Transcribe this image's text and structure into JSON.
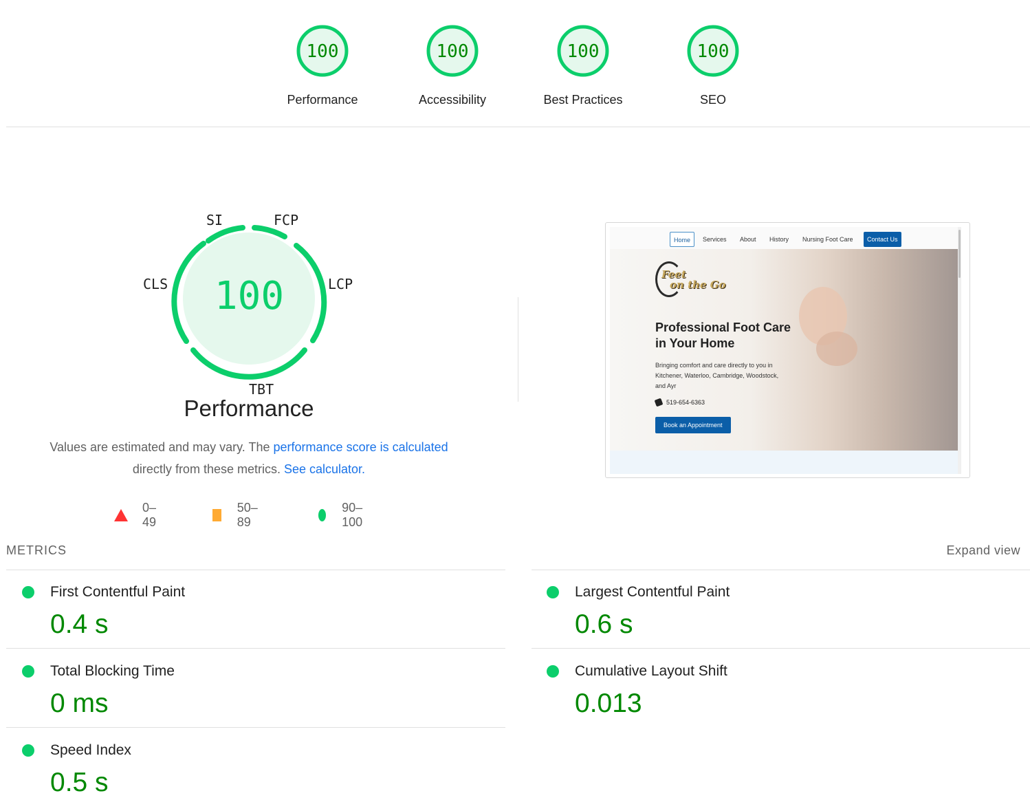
{
  "top_scores": [
    {
      "label": "Performance",
      "score": "100"
    },
    {
      "label": "Accessibility",
      "score": "100"
    },
    {
      "label": "Best Practices",
      "score": "100"
    },
    {
      "label": "SEO",
      "score": "100"
    }
  ],
  "performance_gauge": {
    "score": "100",
    "title": "Performance",
    "segments": [
      "SI",
      "FCP",
      "LCP",
      "TBT",
      "CLS"
    ]
  },
  "description": {
    "part1": "Values are estimated and may vary. The ",
    "link1": "performance score is calculated",
    "part2": "directly from these metrics. ",
    "link2": "See calculator."
  },
  "legend": [
    {
      "shape": "triangle",
      "range": "0–49",
      "color": "#ff3333"
    },
    {
      "shape": "square",
      "range": "50–89",
      "color": "#ffaa33"
    },
    {
      "shape": "circle",
      "range": "90–100",
      "color": "#0cce6b"
    }
  ],
  "screenshot": {
    "nav": [
      "Home",
      "Services",
      "About",
      "History",
      "Nursing Foot Care",
      "Contact Us"
    ],
    "logo_line1": "Feet",
    "logo_line2": "on the Go",
    "hero_title": "Professional Foot Care in Your Home",
    "hero_subtitle": "Bringing comfort and care directly to you in Kitchener, Waterloo, Cambridge, Woodstock, and Ayr",
    "phone": "519-654-6363",
    "cta": "Book an Appointment"
  },
  "metrics": {
    "header": "METRICS",
    "expand_label": "Expand view",
    "items": [
      {
        "name": "First Contentful Paint",
        "value": "0.4 s"
      },
      {
        "name": "Largest Contentful Paint",
        "value": "0.6 s"
      },
      {
        "name": "Total Blocking Time",
        "value": "0 ms"
      },
      {
        "name": "Cumulative Layout Shift",
        "value": "0.013"
      },
      {
        "name": "Speed Index",
        "value": "0.5 s"
      }
    ]
  },
  "colors": {
    "pass": "#0cce6b",
    "pass_text": "#008800",
    "pass_fill": "#e5f8ed",
    "link": "#1a73e8"
  }
}
